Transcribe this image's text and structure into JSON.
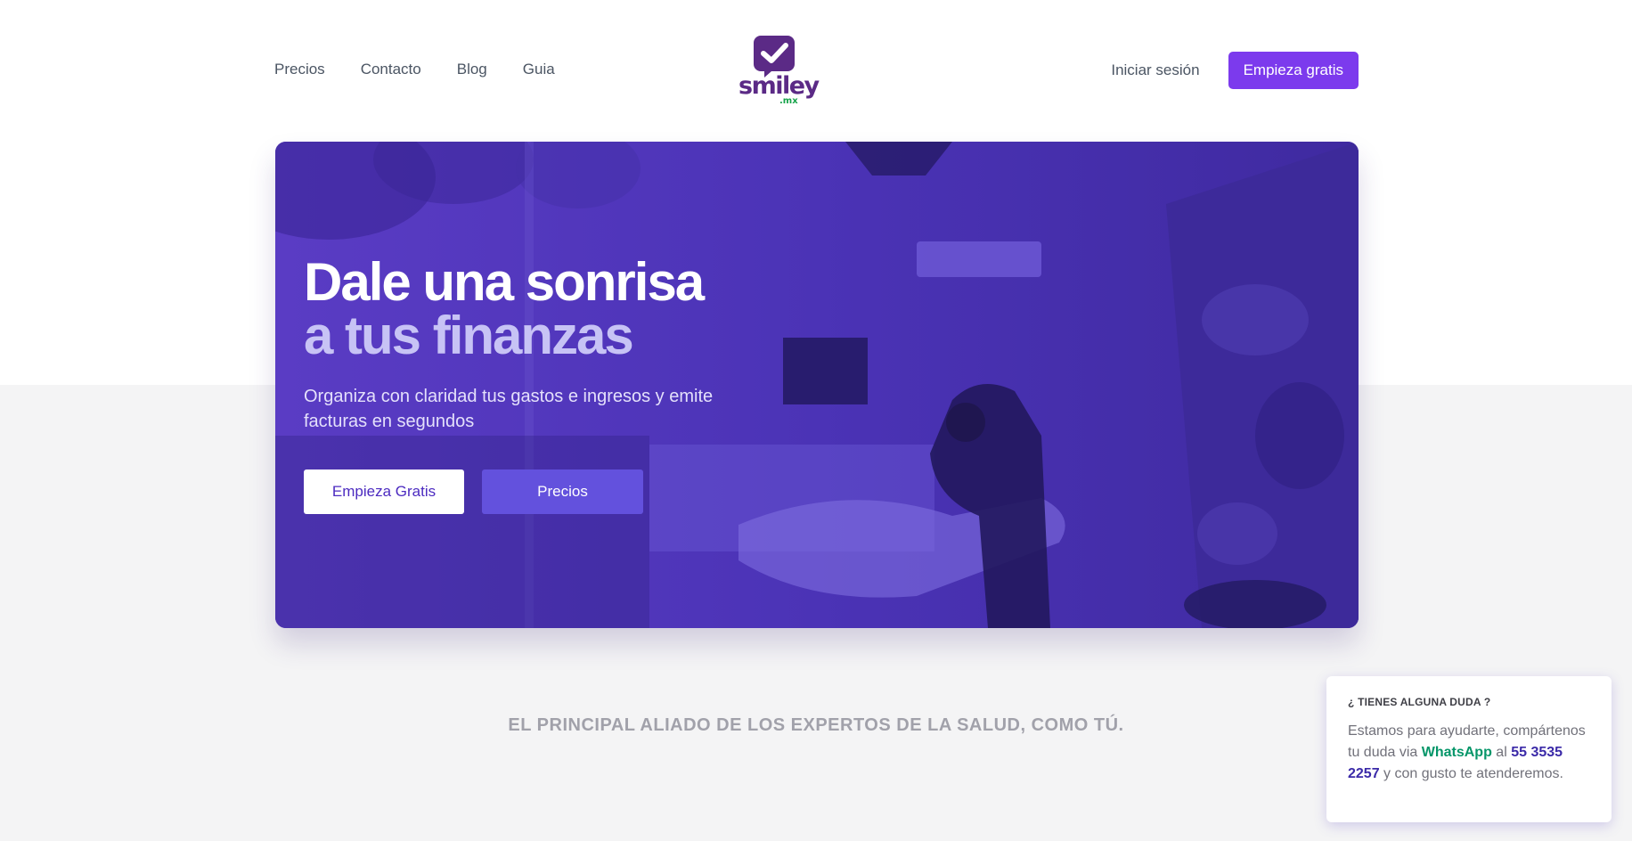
{
  "nav": {
    "links": [
      "Precios",
      "Contacto",
      "Blog",
      "Guia"
    ],
    "login": "Iniciar sesión",
    "cta": "Empieza gratis"
  },
  "logo": {
    "word": "smiley",
    "sub": ".mx"
  },
  "hero": {
    "title_line1": "Dale una sonrisa",
    "title_line2": "a tus finanzas",
    "subtitle": "Organiza con claridad tus gastos e ingresos y emite facturas en segundos",
    "primary_button": "Empieza Gratis",
    "secondary_button": "Precios"
  },
  "tagline": "EL PRINCIPAL ALIADO DE LOS EXPERTOS DE LA SALUD, COMO TÚ.",
  "help": {
    "title": "¿ TIENES ALGUNA DUDA ?",
    "text_before": "Estamos para ayudarte, compártenos tu duda via",
    "whatsapp": "WhatsApp",
    "al": "al",
    "phone": "55 3535 2257",
    "text_after": "y con gusto te atenderemos."
  },
  "colors": {
    "brand_purple": "#7c3aed",
    "hero_overlay": "#4d34b8",
    "whatsapp_green": "#059669",
    "phone_blue": "#3b2aa8"
  }
}
